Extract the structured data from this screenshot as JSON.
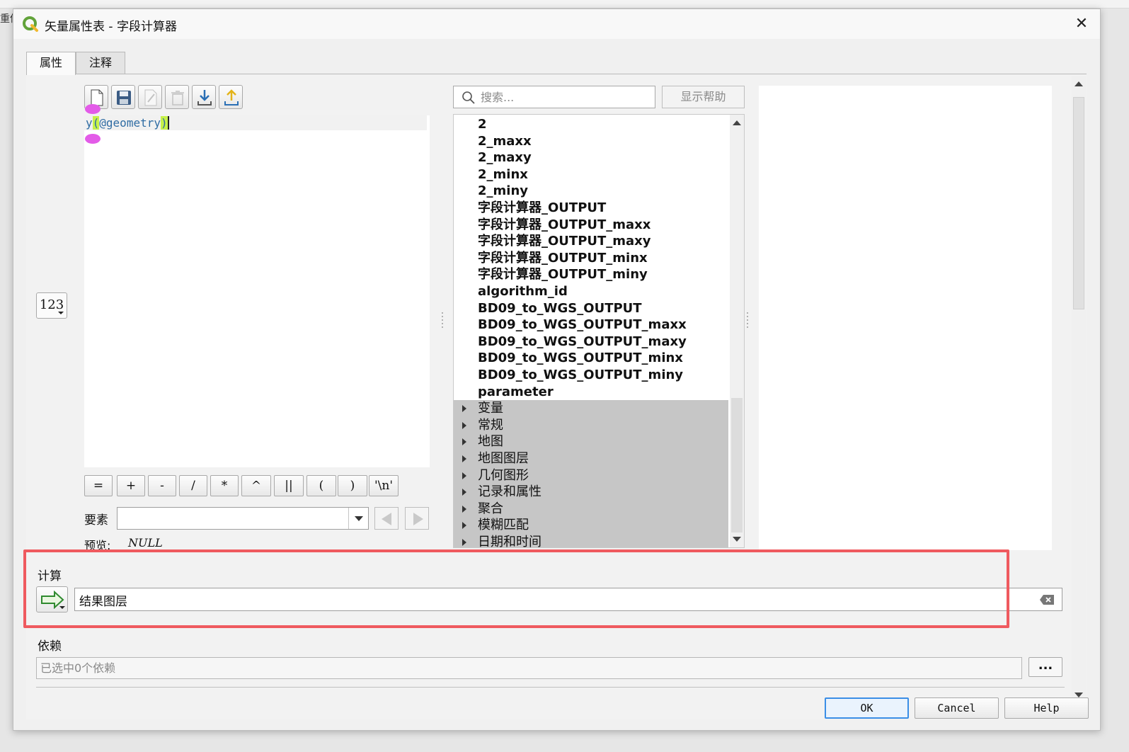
{
  "background": {
    "left_text": "重借"
  },
  "window": {
    "title": "矢量属性表 - 字段计算器"
  },
  "tabs": [
    {
      "label": "属性"
    },
    {
      "label": "注释"
    }
  ],
  "editor": {
    "expression_prefix": "y",
    "expression_open": "(",
    "expression_arg": "@geometry",
    "expression_close": ")"
  },
  "field_type_badge": "123",
  "operators": [
    "=",
    "+",
    "-",
    "/",
    "*",
    "^",
    "||",
    "(",
    ")",
    "'\\n'"
  ],
  "feature": {
    "label": "要素",
    "value": ""
  },
  "preview": {
    "label": "预览:",
    "value": "NULL"
  },
  "search": {
    "placeholder": "搜索..."
  },
  "show_help_label": "显示帮助",
  "tree": {
    "fields": [
      "2",
      "2_maxx",
      "2_maxy",
      "2_minx",
      "2_miny",
      "字段计算器_OUTPUT",
      "字段计算器_OUTPUT_maxx",
      "字段计算器_OUTPUT_maxy",
      "字段计算器_OUTPUT_minx",
      "字段计算器_OUTPUT_miny",
      "algorithm_id",
      "BD09_to_WGS_OUTPUT",
      "BD09_to_WGS_OUTPUT_maxx",
      "BD09_to_WGS_OUTPUT_maxy",
      "BD09_to_WGS_OUTPUT_minx",
      "BD09_to_WGS_OUTPUT_miny",
      "parameter"
    ],
    "groups": [
      "变量",
      "常规",
      "地图",
      "地图图层",
      "几何图形",
      "记录和属性",
      "聚合",
      "模糊匹配",
      "日期和时间"
    ]
  },
  "calc": {
    "label": "计算",
    "value": "结果图层"
  },
  "dependencies": {
    "label": "依赖",
    "placeholder": "已选中0个依赖",
    "button": "..."
  },
  "footer": {
    "ok": "OK",
    "cancel": "Cancel",
    "help": "Help"
  },
  "colors": {
    "highlight_border": "#ef5a5f",
    "default_button": "#3a8ee6",
    "group_bg": "#c6c6c6"
  }
}
